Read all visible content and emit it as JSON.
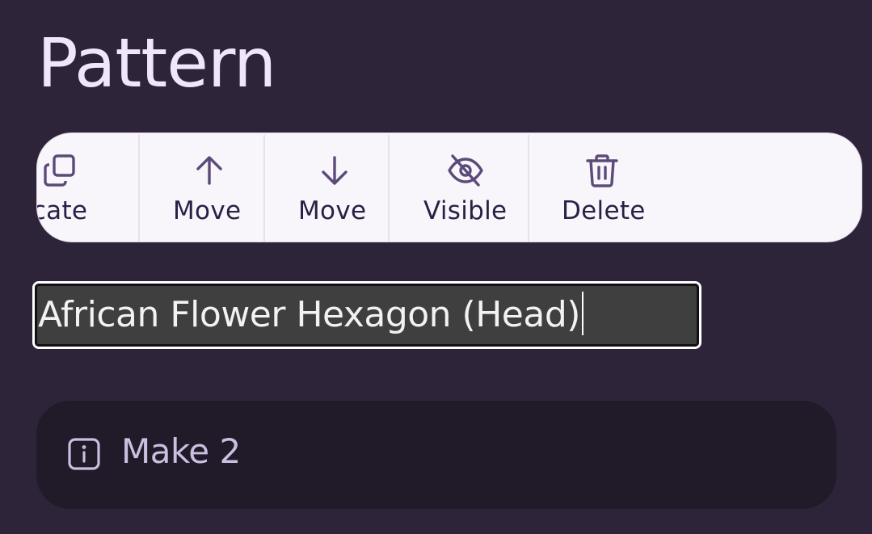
{
  "header": {
    "title": "Pattern"
  },
  "toolbar": {
    "items": [
      {
        "label": "plicate",
        "icon": "duplicate-icon"
      },
      {
        "label": "Move",
        "icon": "arrow-up-icon"
      },
      {
        "label": "Move",
        "icon": "arrow-down-icon"
      },
      {
        "label": "Visible",
        "icon": "eye-off-icon"
      },
      {
        "label": "Delete",
        "icon": "trash-icon"
      }
    ]
  },
  "section_name": {
    "value": "African Flower Hexagon (Head)"
  },
  "note": {
    "icon": "info-icon",
    "text": "Make 2"
  },
  "colors": {
    "background": "#2d2439",
    "toolbar_bg": "#f8f6fb",
    "icon": "#5b4a7a",
    "note_bg": "#201a29",
    "title": "#efe6fb"
  }
}
